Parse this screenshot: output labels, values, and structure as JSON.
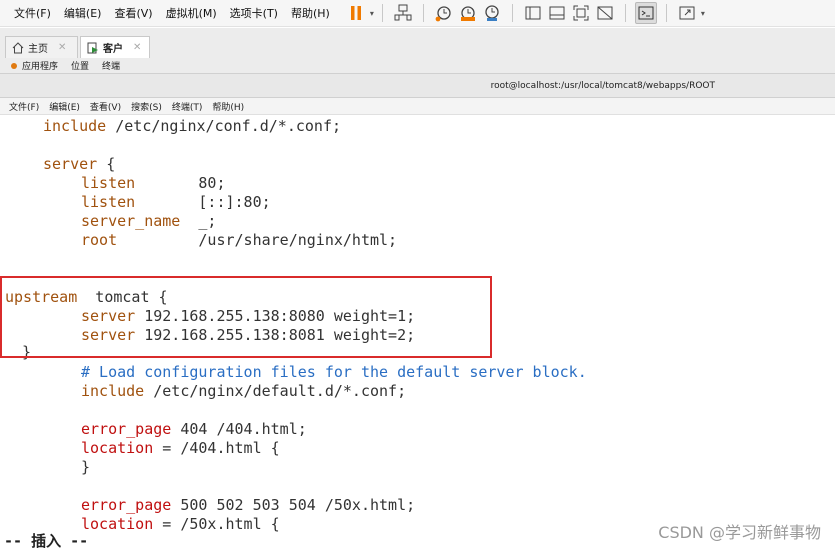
{
  "menubar": {
    "items": [
      "文件(F)",
      "编辑(E)",
      "查看(V)",
      "虚拟机(M)",
      "选项卡(T)",
      "帮助(H)"
    ]
  },
  "tabs": [
    {
      "label": "主页",
      "icon": "home-icon"
    },
    {
      "label": "客户",
      "icon": "vm-icon"
    }
  ],
  "gnome_bar": {
    "items": [
      "应用程序",
      "位置",
      "终端"
    ]
  },
  "terminal": {
    "title": "root@localhost:/usr/local/tomcat8/webapps/ROOT",
    "menu": [
      "文件(F)",
      "编辑(E)",
      "查看(V)",
      "搜索(S)",
      "终端(T)",
      "帮助(H)"
    ]
  },
  "code": {
    "l1_kw": "include",
    "l1_rest": " /etc/nginx/conf.d/*.conf;",
    "l2_kw": "server",
    "l2_rest": " {",
    "l3_kw": "listen",
    "l3_rest": "       80;",
    "l4_kw": "listen",
    "l4_rest": "       [::]:80;",
    "l5_kw": "server_name",
    "l5_rest": "  _;",
    "l6_kw": "root",
    "l6_rest": "         /usr/share/nginx/html;",
    "l7_kw": "upstream",
    "l7_rest": "  tomcat {",
    "l8_kw": "server",
    "l8_rest": " 192.168.255.138:8080 weight=1;",
    "l9_kw": "server",
    "l9_rest": " 192.168.255.138:8081 weight=2;",
    "l10": "}",
    "l11_comment": "# Load configuration files for the default server block.",
    "l12_kw": "include",
    "l12_rest": " /etc/nginx/default.d/*.conf;",
    "l13_kw": "error_page",
    "l13_rest": " 404 /404.html;",
    "l14_kw": "location",
    "l14_rest": " = /404.html {",
    "l15": "}",
    "l16_kw": "error_page",
    "l16_rest": " 500 502 503 504 /50x.html;",
    "l17_kw": "location",
    "l17_rest": " = /50x.html {"
  },
  "status_line": "-- 插入 --",
  "watermark": "CSDN @学习新鲜事物"
}
